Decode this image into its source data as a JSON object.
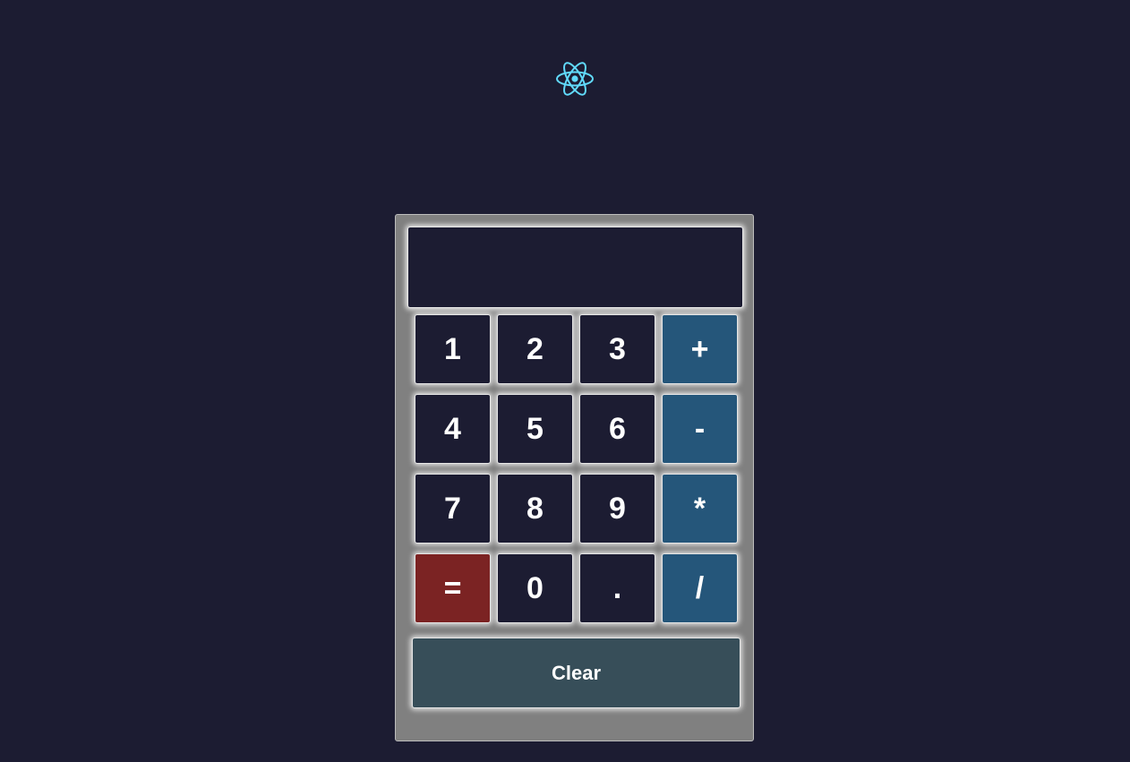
{
  "logo": {
    "icon": "react-atom-icon",
    "color": "#61dafb"
  },
  "calculator": {
    "display_value": "",
    "keys": {
      "k1": "1",
      "k2": "2",
      "k3": "3",
      "add": "+",
      "k4": "4",
      "k5": "5",
      "k6": "6",
      "subtract": "-",
      "k7": "7",
      "k8": "8",
      "k9": "9",
      "multiply": "*",
      "equals": "=",
      "k0": "0",
      "decimal": ".",
      "divide": "/"
    },
    "clear_label": "Clear"
  },
  "colors": {
    "background": "#1c1c32",
    "panel": "#808080",
    "operator": "#25567a",
    "equals": "#7b2323",
    "clear": "#374e59"
  }
}
